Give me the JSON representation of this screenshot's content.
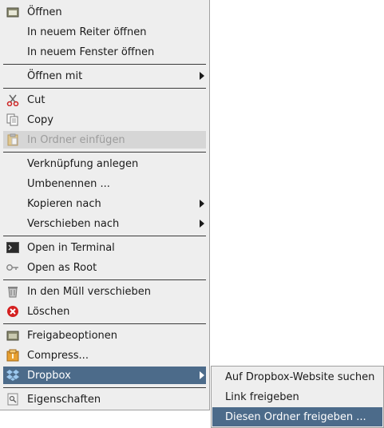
{
  "menu": {
    "open": "Öffnen",
    "open_new_tab": "In neuem Reiter öffnen",
    "open_new_window": "In neuem Fenster öffnen",
    "open_with": "Öffnen mit",
    "cut": "Cut",
    "copy": "Copy",
    "paste_into_folder": "In Ordner einfügen",
    "create_link": "Verknüpfung anlegen",
    "rename": "Umbenennen ...",
    "copy_to": "Kopieren nach",
    "move_to": "Verschieben nach",
    "open_in_terminal": "Open in Terminal",
    "open_as_root": "Open as Root",
    "move_to_trash": "In den Müll verschieben",
    "delete": "Löschen",
    "sharing_options": "Freigabeoptionen",
    "compress": "Compress...",
    "dropbox": "Dropbox",
    "properties": "Eigenschaften"
  },
  "submenu": {
    "dropbox_website": "Auf Dropbox-Website suchen",
    "share_link": "Link freigeben",
    "share_folder": "Diesen Ordner freigeben ..."
  },
  "colors": {
    "menu_bg": "#eeeeee",
    "highlight": "#4c6b8a",
    "disabled_bg": "#d6d6d6"
  }
}
